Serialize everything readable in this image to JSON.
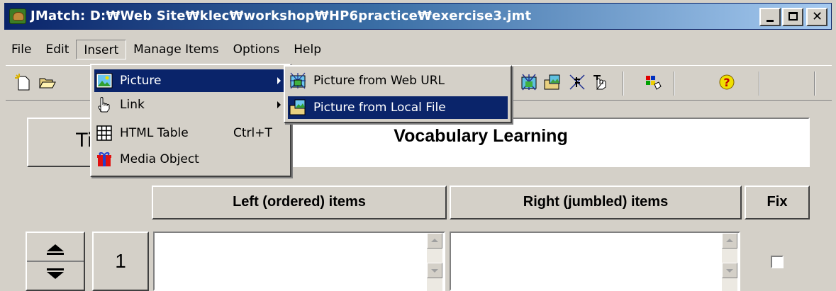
{
  "window": {
    "title": "JMatch: D:₩Web Site₩klec₩workshop₩HP6practice₩exercise3.jmt",
    "title_bar_color": "#0a246a",
    "icons": {
      "app": "jmatch-icon",
      "minimize": "minimize-icon",
      "maximize": "maximize-icon",
      "close": "close-icon"
    },
    "close_glyph": "✕"
  },
  "menubar": {
    "items": [
      {
        "label": "File"
      },
      {
        "label": "Edit"
      },
      {
        "label": "Insert"
      },
      {
        "label": "Manage Items"
      },
      {
        "label": "Options"
      },
      {
        "label": "Help"
      }
    ],
    "open_menu": "Insert"
  },
  "toolbar": {
    "icons": [
      "new-file-icon",
      "open-folder-icon",
      "web-picture-icon",
      "local-picture-icon",
      "link-icon",
      "link-cut-icon",
      "palette-icon",
      "help-icon"
    ],
    "help_glyph": "?"
  },
  "insert_menu": {
    "items": [
      {
        "label": "Picture",
        "icon": "picture-icon",
        "submenu": true,
        "highlighted": true
      },
      {
        "label": "Link",
        "icon": "hand-link-icon",
        "submenu": true
      },
      {
        "label": "HTML Table",
        "icon": "table-icon",
        "shortcut": "Ctrl+T"
      },
      {
        "label": "Media Object",
        "icon": "gift-icon"
      }
    ]
  },
  "picture_submenu": {
    "items": [
      {
        "label": "Picture from Web URL",
        "icon": "web-picture-icon"
      },
      {
        "label": "Picture from Local File",
        "icon": "folder-picture-icon",
        "highlighted": true
      }
    ]
  },
  "main": {
    "title_button": "Tit",
    "title_value": "Vocabulary Learning",
    "headers": {
      "left": "Left (ordered) items",
      "right": "Right (jumbled) items",
      "fix": "Fix"
    },
    "rows": [
      {
        "number": "1",
        "left": "",
        "right": "",
        "fixed": false
      }
    ]
  },
  "colors": {
    "highlight": "#0a246a",
    "face": "#d4d0c8"
  }
}
